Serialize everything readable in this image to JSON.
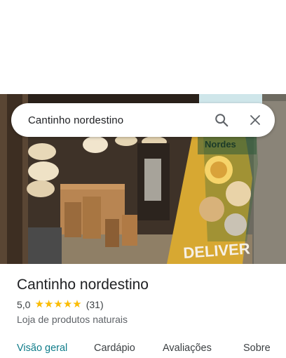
{
  "search": {
    "query": "Cantinho nordestino",
    "search_icon": "search-icon",
    "close_icon": "close-icon"
  },
  "photo": {
    "banner_text": "DELIVER",
    "sign_text": "Nordes"
  },
  "place": {
    "name": "Cantinho nordestino",
    "rating": "5,0",
    "stars": 5,
    "reviews": "(31)",
    "category": "Loja de produtos naturais"
  },
  "tabs": [
    {
      "label": "Visão geral",
      "active": true
    },
    {
      "label": "Cardápio",
      "active": false
    },
    {
      "label": "Avaliações",
      "active": false
    },
    {
      "label": "Sobre",
      "active": false
    }
  ],
  "colors": {
    "accent": "#0f7c8a",
    "star": "#fbbc04",
    "text_primary": "#202124",
    "text_secondary": "#5f6368"
  }
}
